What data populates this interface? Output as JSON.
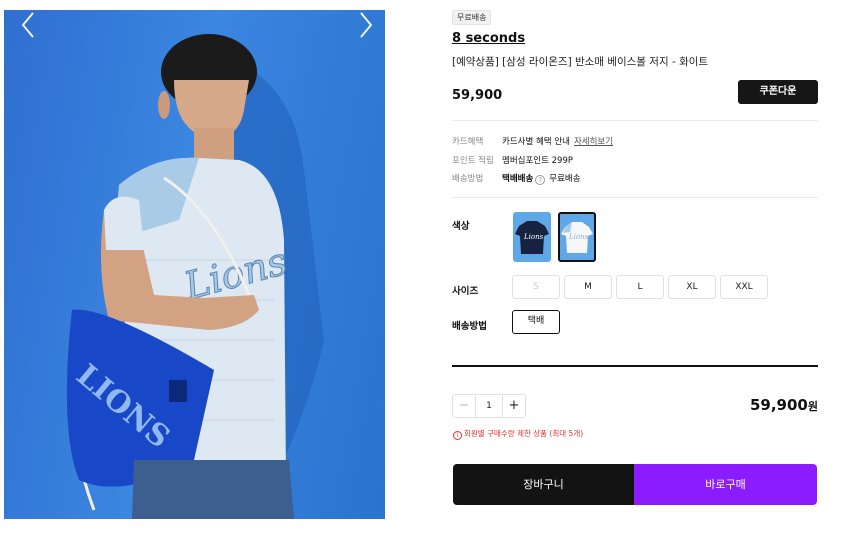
{
  "badge": "무료배송",
  "brand": "8 seconds",
  "product_name": "[예약상품] [삼성 라이온즈] 반소매 베이스볼 저지 - 화이트",
  "price": "59,900",
  "coupon_button": "쿠폰다운",
  "info": {
    "card": {
      "label": "카드혜택",
      "value": "카드사별 혜택 안내",
      "link": "자세히보기"
    },
    "point": {
      "label": "포인트 적립",
      "value": "멤버십포인트 299P"
    },
    "shipping": {
      "label": "배송방법",
      "value": "택배배송",
      "help_icon": "?",
      "extra": "무료배송"
    }
  },
  "options": {
    "color_label": "색상",
    "colors": [
      "navy",
      "white"
    ],
    "size_label": "사이즈",
    "sizes": [
      "S",
      "M",
      "L",
      "XL",
      "XXL"
    ],
    "shipping_label": "배송방법",
    "shipping_option": "택배"
  },
  "quantity": {
    "minus": "−",
    "value": "1",
    "plus": "+"
  },
  "total": {
    "amount": "59,900",
    "unit": "원"
  },
  "limit_note": {
    "icon": "i",
    "text": "회원별 구매수량 제한 상품 (최대 5개)"
  },
  "buttons": {
    "cart": "장바구니",
    "buy": "바로구매"
  },
  "colors": {
    "accent": "#8a1cff",
    "dark": "#131313",
    "warning": "#e5332a",
    "background_blue": "#3b86e0"
  }
}
